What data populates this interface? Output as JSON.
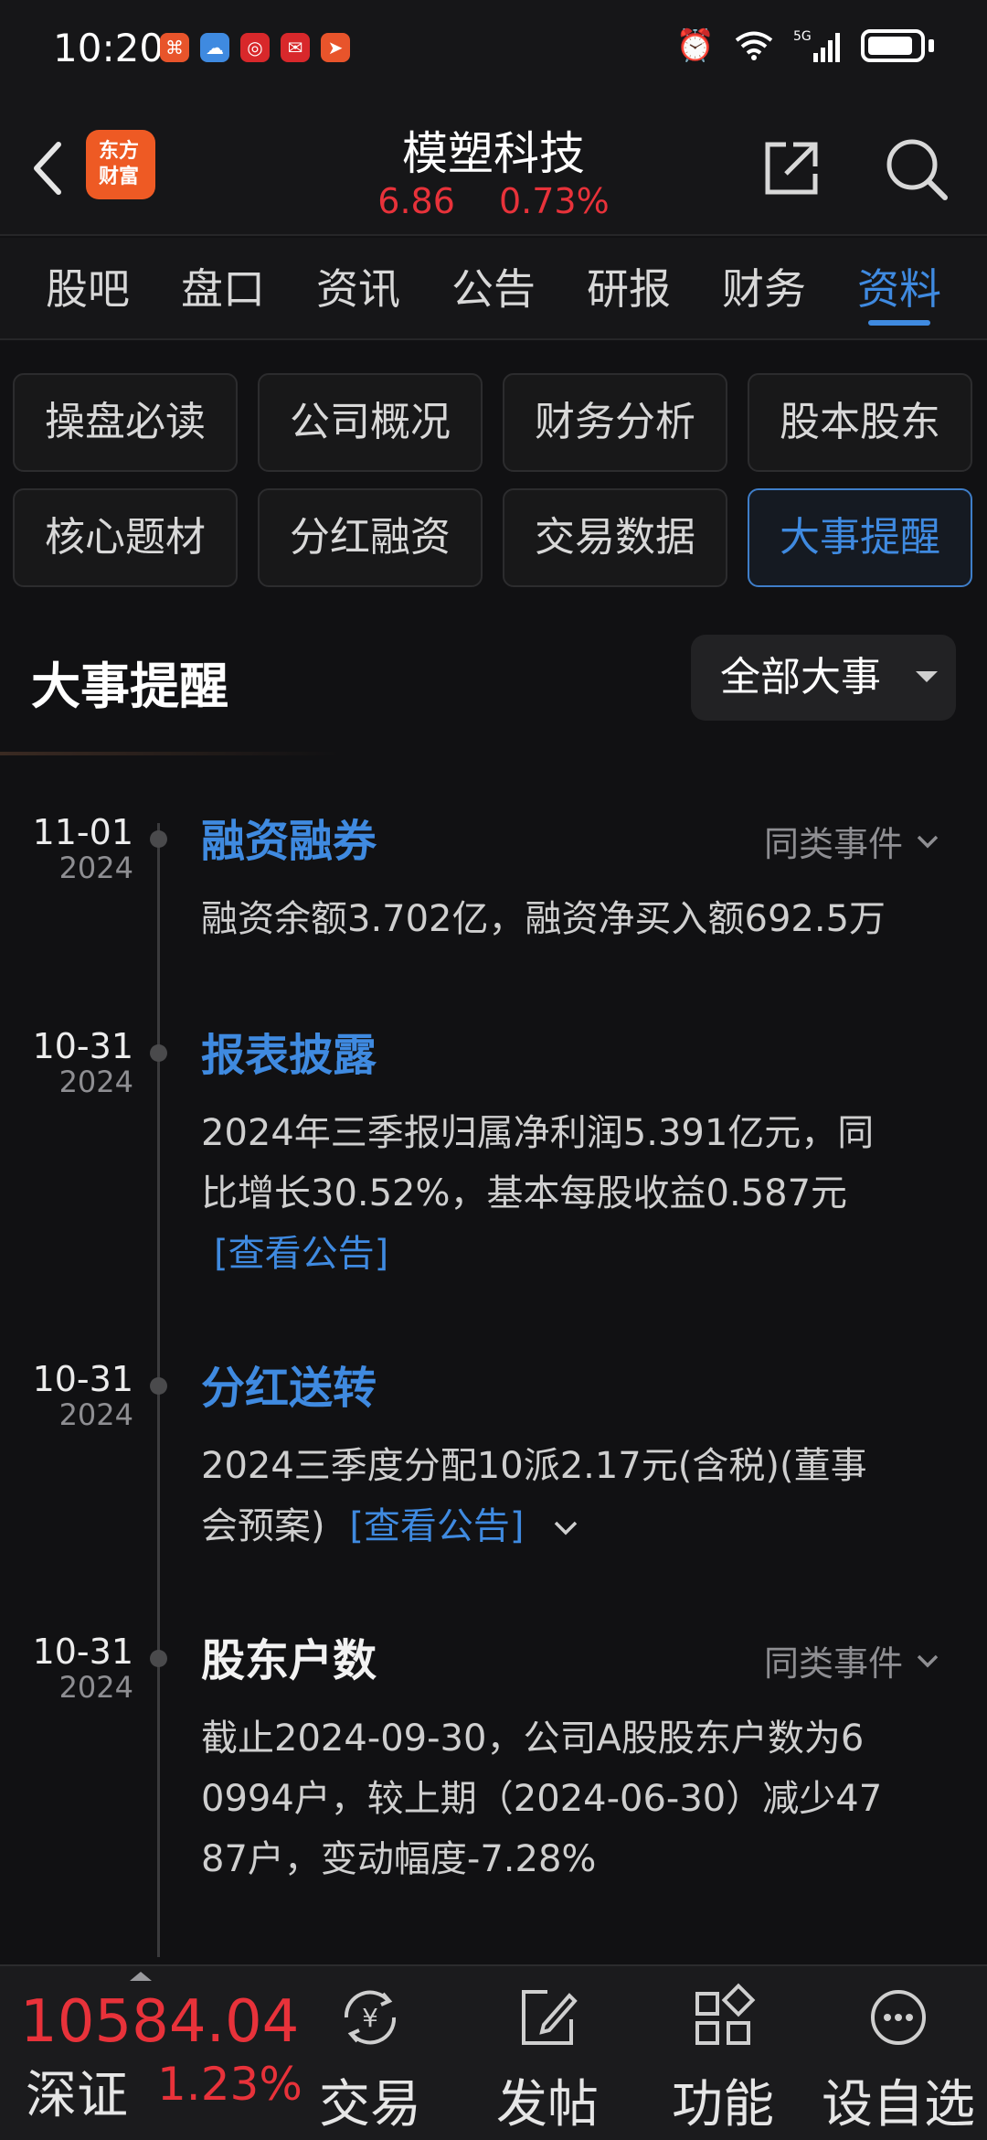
{
  "status_bar": {
    "time": "10:20",
    "network": "5G"
  },
  "header": {
    "brand_logo": "东方财富",
    "stock_name": "模塑科技",
    "price": "6.86",
    "change_pct": "0.73%"
  },
  "tabs": [
    "股吧",
    "盘口",
    "资讯",
    "公告",
    "研报",
    "财务",
    "资料"
  ],
  "active_tab": "资料",
  "sub_menu": [
    "操盘必读",
    "公司概况",
    "财务分析",
    "股本股东",
    "核心题材",
    "分红融资",
    "交易数据",
    "大事提醒"
  ],
  "active_sub": "大事提醒",
  "section": {
    "title": "大事提醒",
    "filter_label": "全部大事"
  },
  "events": [
    {
      "date": "11-01",
      "year": "2024",
      "title": "融资融券",
      "similar": "同类事件",
      "body": "融资余额3.702亿，融资净买入额692.5万"
    },
    {
      "date": "10-31",
      "year": "2024",
      "title": "报表披露",
      "body_lines": [
        "2024年三季报归属净利润5.391亿元，同",
        "比增长30.52%，基本每股收益0.587元"
      ],
      "link": "[查看公告]"
    },
    {
      "date": "10-31",
      "year": "2024",
      "title": "分红送转",
      "body_lines": [
        "2024三季度分配10派2.17元(含税)(董事",
        "会预案)"
      ],
      "link": "[查看公告]"
    },
    {
      "date": "10-31",
      "year": "2024",
      "title": "股东户数",
      "similar": "同类事件",
      "body_lines": [
        "截止2024-09-30，公司A股股东户数为6",
        "0994户，较上期（2024-06-30）减少47",
        "87户，变动幅度-7.28%"
      ]
    }
  ],
  "bottom": {
    "index_value": "10584.04",
    "index_name": "深证",
    "index_pct": "1.23%",
    "nav": [
      "交易",
      "发帖",
      "功能",
      "设自选"
    ]
  },
  "colors": {
    "accent_blue": "#3f8ae0",
    "up_red": "#e8323a",
    "background": "#111113"
  }
}
